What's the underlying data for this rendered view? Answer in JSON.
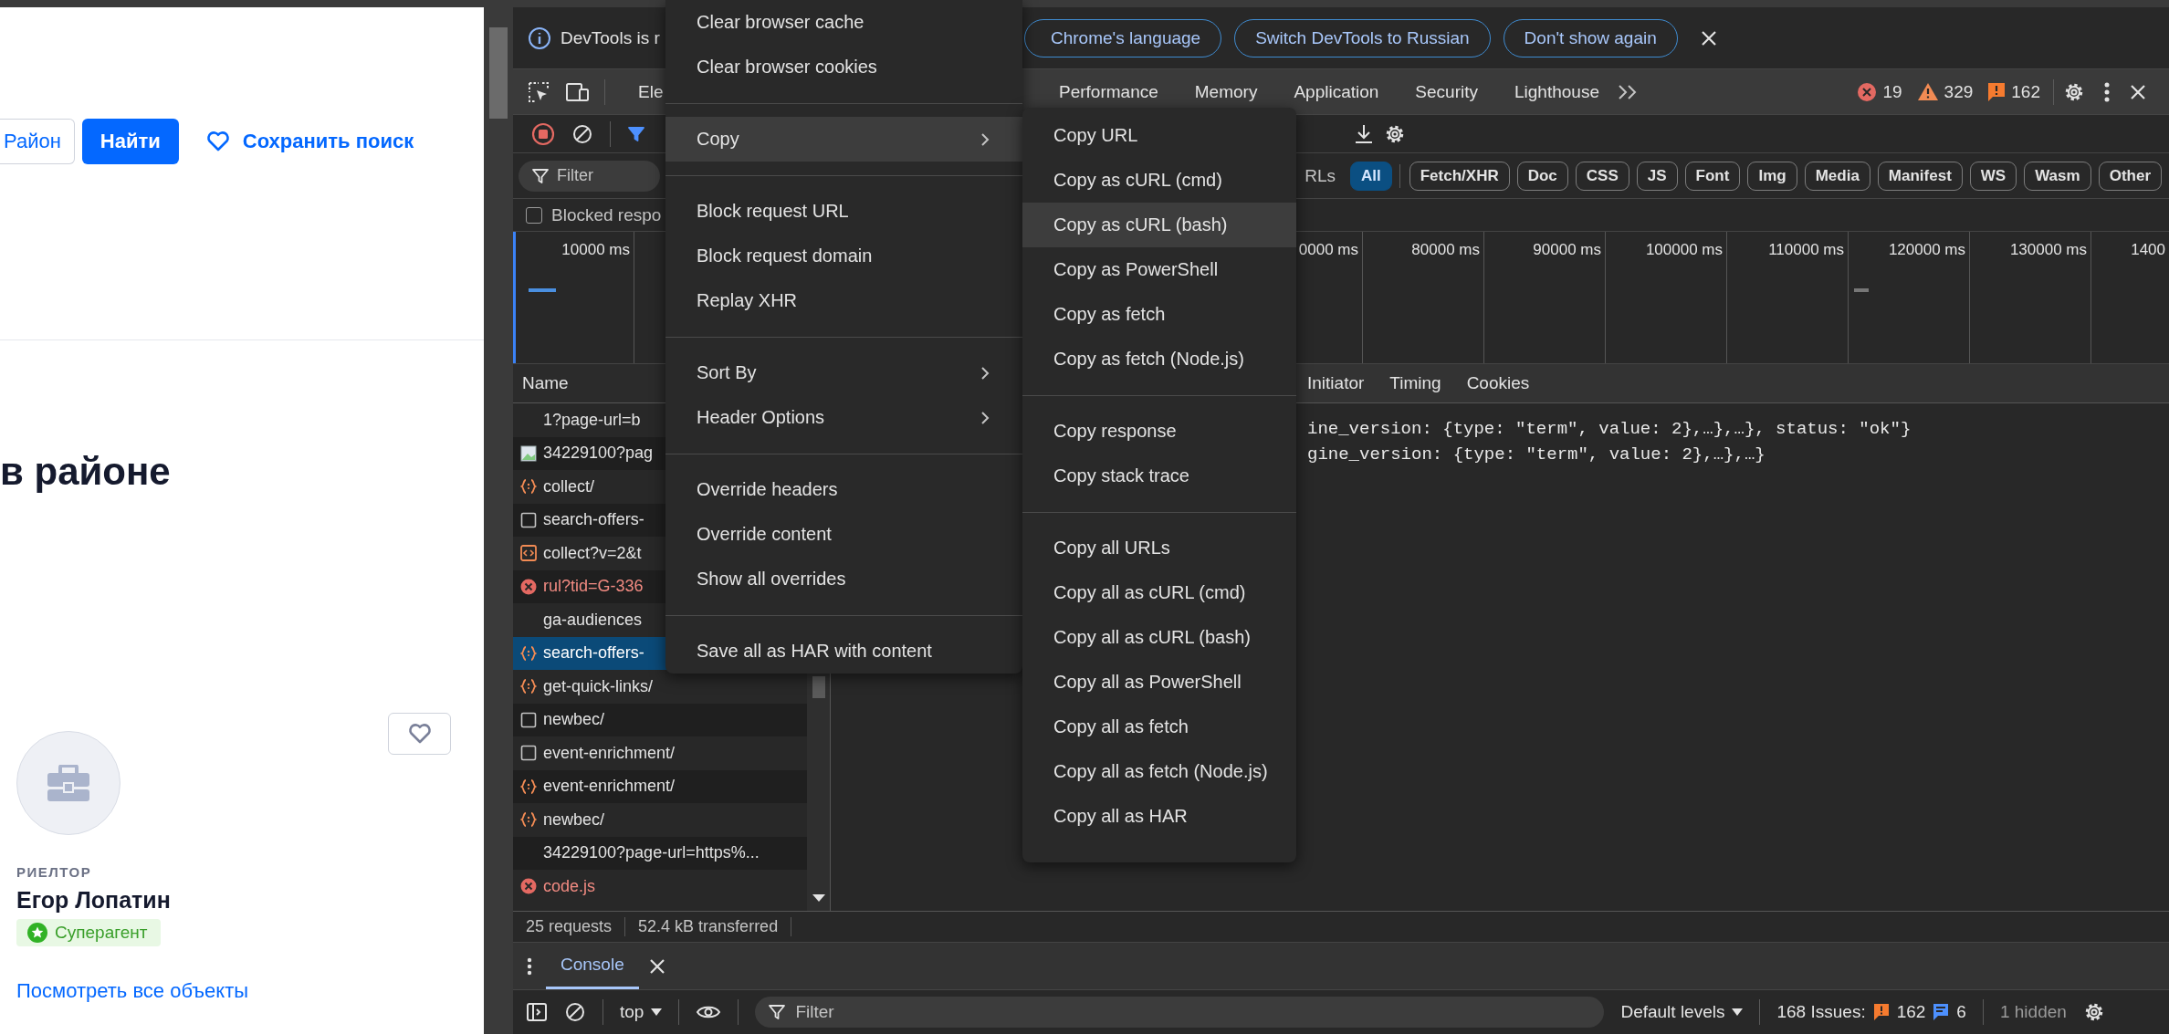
{
  "page": {
    "search_bar": {
      "district_button": "Район",
      "find_button": "Найти",
      "save_search": "Сохранить поиск"
    },
    "heading": "в районе",
    "agent_card": {
      "role": "РИЕЛТОР",
      "name": "Егор Лопатин",
      "badge": "Суперагент",
      "link": "Посмотреть все объекты"
    }
  },
  "devtools": {
    "infobar": {
      "message": "DevTools is r",
      "buttons": [
        "Chrome's language",
        "Switch DevTools to Russian",
        "Don't show again"
      ]
    },
    "panel_tabs": [
      {
        "label": "Ele",
        "selected": false
      },
      {
        "label": "Performance",
        "selected": false
      },
      {
        "label": "Memory",
        "selected": false
      },
      {
        "label": "Application",
        "selected": false
      },
      {
        "label": "Security",
        "selected": false
      },
      {
        "label": "Lighthouse",
        "selected": false
      }
    ],
    "counters": {
      "errors": "19",
      "warnings": "329",
      "issues": "162"
    },
    "filter": {
      "placeholder": "Filter"
    },
    "filter_fragment": "RLs",
    "type_filters": [
      {
        "label": "All",
        "selected": true
      },
      {
        "label": "Fetch/XHR",
        "selected": false
      },
      {
        "label": "Doc",
        "selected": false
      },
      {
        "label": "CSS",
        "selected": false
      },
      {
        "label": "JS",
        "selected": false
      },
      {
        "label": "Font",
        "selected": false
      },
      {
        "label": "Img",
        "selected": false
      },
      {
        "label": "Media",
        "selected": false
      },
      {
        "label": "Manifest",
        "selected": false
      },
      {
        "label": "WS",
        "selected": false
      },
      {
        "label": "Wasm",
        "selected": false
      },
      {
        "label": "Other",
        "selected": false
      }
    ],
    "blocked_checkbox": {
      "label": "Blocked respo",
      "checked": false
    },
    "timeline": {
      "left_ticks": [
        "10000 ms"
      ],
      "right_ticks": [
        "0000 ms",
        "80000 ms",
        "90000 ms",
        "100000 ms",
        "110000 ms",
        "120000 ms",
        "130000 ms",
        "1400"
      ]
    },
    "requests": {
      "column": "Name",
      "rows": [
        {
          "name": "1?page-url=b",
          "kind": "none",
          "selected": false
        },
        {
          "name": "34229100?pag",
          "kind": "image",
          "selected": false
        },
        {
          "name": "collect/",
          "kind": "json",
          "selected": false
        },
        {
          "name": "search-offers-",
          "kind": "doc",
          "selected": false
        },
        {
          "name": "collect?v=2&t",
          "kind": "script",
          "selected": false
        },
        {
          "name": "rul?tid=G-336",
          "kind": "error",
          "selected": false
        },
        {
          "name": "ga-audiences",
          "kind": "none",
          "selected": false
        },
        {
          "name": "search-offers-",
          "kind": "json",
          "selected": true
        },
        {
          "name": "get-quick-links/",
          "kind": "json",
          "selected": false
        },
        {
          "name": "newbec/",
          "kind": "doc",
          "selected": false
        },
        {
          "name": "event-enrichment/",
          "kind": "doc",
          "selected": false
        },
        {
          "name": "event-enrichment/",
          "kind": "json",
          "selected": false
        },
        {
          "name": "newbec/",
          "kind": "json",
          "selected": false
        },
        {
          "name": "34229100?page-url=https%...",
          "kind": "none",
          "selected": false
        },
        {
          "name": "code.js",
          "kind": "error",
          "selected": false
        }
      ]
    },
    "detail_tabs": [
      {
        "label": "Initiator",
        "selected": false
      },
      {
        "label": "Timing",
        "selected": false
      },
      {
        "label": "Cookies",
        "selected": false
      }
    ],
    "response_lines": [
      "ine_version: {type: \"term\", value: 2},…},…}, status: \"ok\"}",
      "gine_version: {type: \"term\", value: 2},…},…}"
    ],
    "status_bar": {
      "requests": "25 requests",
      "transferred": "52.4 kB transferred"
    },
    "drawer": {
      "tabs": [
        {
          "label": "Console",
          "selected": true
        }
      ],
      "context": "top",
      "filter": {
        "placeholder": "Filter"
      },
      "levels": "Default levels",
      "issues_label": "168 Issues:",
      "issue_counts": [
        {
          "kind": "warning",
          "count": "162"
        },
        {
          "kind": "info",
          "count": "6"
        }
      ],
      "hidden": "1 hidden"
    }
  },
  "context_menu": {
    "items": [
      {
        "kind": "item",
        "label": "Clear browser cache",
        "selected": false,
        "submenu": false
      },
      {
        "kind": "item",
        "label": "Clear browser cookies",
        "selected": false,
        "submenu": false
      },
      {
        "kind": "separator"
      },
      {
        "kind": "item",
        "label": "Copy",
        "selected": true,
        "submenu": true
      },
      {
        "kind": "separator"
      },
      {
        "kind": "item",
        "label": "Block request URL",
        "selected": false,
        "submenu": false
      },
      {
        "kind": "item",
        "label": "Block request domain",
        "selected": false,
        "submenu": false
      },
      {
        "kind": "item",
        "label": "Replay XHR",
        "selected": false,
        "submenu": false
      },
      {
        "kind": "separator"
      },
      {
        "kind": "item",
        "label": "Sort By",
        "selected": false,
        "submenu": true
      },
      {
        "kind": "item",
        "label": "Header Options",
        "selected": false,
        "submenu": true
      },
      {
        "kind": "separator"
      },
      {
        "kind": "item",
        "label": "Override headers",
        "selected": false,
        "submenu": false
      },
      {
        "kind": "item",
        "label": "Override content",
        "selected": false,
        "submenu": false
      },
      {
        "kind": "item",
        "label": "Show all overrides",
        "selected": false,
        "submenu": false
      },
      {
        "kind": "separator"
      },
      {
        "kind": "item",
        "label": "Save all as HAR with content",
        "selected": false,
        "submenu": false
      }
    ]
  },
  "copy_submenu": {
    "items": [
      {
        "kind": "item",
        "label": "Copy URL",
        "selected": false,
        "submenu": false
      },
      {
        "kind": "item",
        "label": "Copy as cURL (cmd)",
        "selected": false,
        "submenu": false
      },
      {
        "kind": "item",
        "label": "Copy as cURL (bash)",
        "selected": true,
        "submenu": false
      },
      {
        "kind": "item",
        "label": "Copy as PowerShell",
        "selected": false,
        "submenu": false
      },
      {
        "kind": "item",
        "label": "Copy as fetch",
        "selected": false,
        "submenu": false
      },
      {
        "kind": "item",
        "label": "Copy as fetch (Node.js)",
        "selected": false,
        "submenu": false
      },
      {
        "kind": "separator"
      },
      {
        "kind": "item",
        "label": "Copy response",
        "selected": false,
        "submenu": false
      },
      {
        "kind": "item",
        "label": "Copy stack trace",
        "selected": false,
        "submenu": false
      },
      {
        "kind": "separator"
      },
      {
        "kind": "item",
        "label": "Copy all URLs",
        "selected": false,
        "submenu": false
      },
      {
        "kind": "item",
        "label": "Copy all as cURL (cmd)",
        "selected": false,
        "submenu": false
      },
      {
        "kind": "item",
        "label": "Copy all as cURL (bash)",
        "selected": false,
        "submenu": false
      },
      {
        "kind": "item",
        "label": "Copy all as PowerShell",
        "selected": false,
        "submenu": false
      },
      {
        "kind": "item",
        "label": "Copy all as fetch",
        "selected": false,
        "submenu": false
      },
      {
        "kind": "item",
        "label": "Copy all as fetch (Node.js)",
        "selected": false,
        "submenu": false
      },
      {
        "kind": "item",
        "label": "Copy all as HAR",
        "selected": false,
        "submenu": false
      }
    ]
  }
}
